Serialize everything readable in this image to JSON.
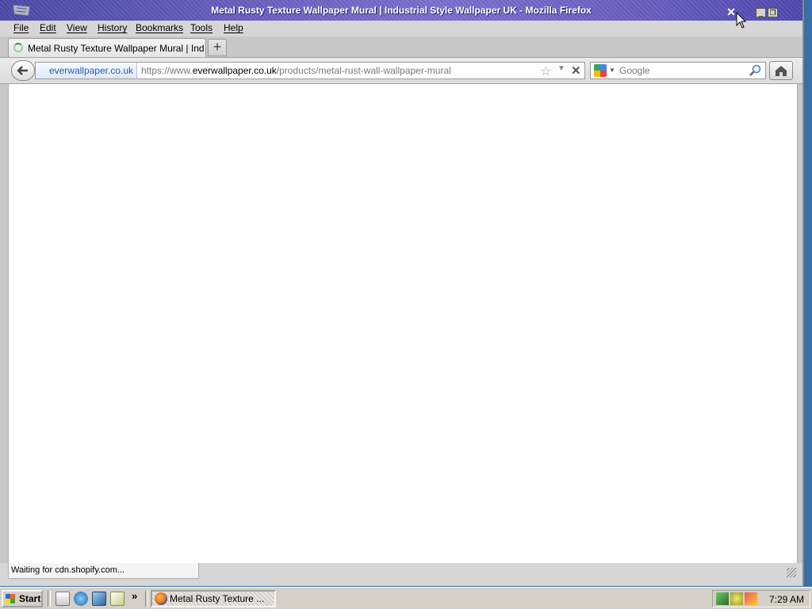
{
  "window": {
    "title": "Metal Rusty Texture Wallpaper Mural | Industrial Style Wallpaper UK - Mozilla Firefox",
    "controls": {
      "minimize": "_",
      "restore": "❐"
    }
  },
  "menu": [
    {
      "label": "File"
    },
    {
      "label": "Edit"
    },
    {
      "label": "View"
    },
    {
      "label": "History"
    },
    {
      "label": "Bookmarks"
    },
    {
      "label": "Tools"
    },
    {
      "label": "Help"
    }
  ],
  "tabs": [
    {
      "title": "Metal Rusty Texture Wallpaper Mural | Industri...",
      "loading": true
    }
  ],
  "newtab_label": "+",
  "navbar": {
    "identity": "everwallpaper.co.uk",
    "url_scheme": "https://www.",
    "url_host": "everwallpaper.co.uk",
    "url_path": "/products/metal-rust-wall-wallpaper-mural",
    "search_placeholder": "Google"
  },
  "status": {
    "text": "Waiting for cdn.shopify.com..."
  },
  "taskbar": {
    "start_label": "Start",
    "more": "»",
    "task_label": "Metal Rusty Texture ...",
    "clock": "7:29 AM"
  },
  "icons": {
    "back": "back-arrow-icon",
    "star": "bookmark-star-icon",
    "stop": "stop-icon",
    "home": "home-icon",
    "search": "magnifier-icon",
    "engine": "google-icon"
  }
}
